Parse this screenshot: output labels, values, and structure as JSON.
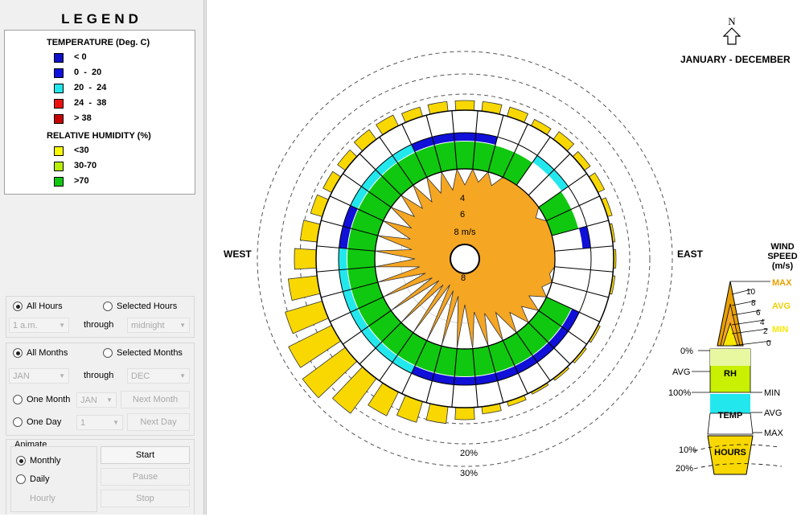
{
  "legend": {
    "title": "LEGEND",
    "temperature_heading": "TEMPERATURE (Deg. C)",
    "temperature_items": [
      {
        "label": "< 0",
        "color": "#1010c8"
      },
      {
        "label": "0  -  20",
        "color": "#1010e0"
      },
      {
        "label": "20  -  24",
        "color": "#22e8ee"
      },
      {
        "label": "24  -  38",
        "color": "#ee1010"
      },
      {
        "label": "> 38",
        "color": "#c80000"
      }
    ],
    "humidity_heading": "RELATIVE HUMIDITY (%)",
    "humidity_items": [
      {
        "label": "<30",
        "color": "#f8f800"
      },
      {
        "label": "30-70",
        "color": "#b8ee00"
      },
      {
        "label": ">70",
        "color": "#10c810"
      }
    ]
  },
  "hours": {
    "all_label": "All Hours",
    "selected_label": "Selected Hours",
    "all_selected": true,
    "from_value": "1 a.m.",
    "through_label": "through",
    "to_value": "midnight"
  },
  "months": {
    "all_label": "All Months",
    "selected_label": "Selected Months",
    "all_selected": true,
    "from_value": "JAN",
    "through_label": "through",
    "to_value": "DEC",
    "one_month_label": "One Month",
    "one_month_value": "JAN",
    "next_month_label": "Next Month",
    "one_day_label": "One Day",
    "one_day_value": "1",
    "next_day_label": "Next Day"
  },
  "animate": {
    "legend": "Animate",
    "monthly_label": "Monthly",
    "daily_label": "Daily",
    "hourly_label": "Hourly",
    "monthly_selected": true,
    "start_label": "Start",
    "pause_label": "Pause",
    "stop_label": "Stop"
  },
  "chart": {
    "north_label": "N",
    "period_label": "JANUARY - DECEMBER",
    "west_label": "WEST",
    "east_label": "EAST",
    "speed_rings": [
      "4",
      "6",
      "8 m/s"
    ],
    "bottom_speed_label": "8",
    "hours_pct_labels": [
      "20%",
      "30%"
    ]
  },
  "key": {
    "title_lines": [
      "WIND",
      "SPEED",
      "(m/s)"
    ],
    "max_label": "MAX",
    "avg_label": "AVG",
    "min_label": "MIN",
    "speed_ticks": [
      "10",
      "8",
      "6",
      "4",
      "2",
      "0"
    ],
    "rh_zero": "0%",
    "rh_avg": "AVG",
    "rh_text": "RH",
    "rh_hundred": "100%",
    "rh_min": "MIN",
    "temp_text": "TEMP",
    "temp_avg": "AVG",
    "temp_max": "MAX",
    "hours_text": "HOURS",
    "hours_10": "10%",
    "hours_20": "20%",
    "max_color": "#e8a000",
    "avg_color": "#f0d000",
    "min_color": "#f8e800"
  },
  "colors": {
    "wind_fill": "#f5a623",
    "hours_fill": "#f8d800",
    "humidity_green": "#10c810",
    "temp_blue": "#1010d8",
    "temp_cyan": "#22e8ee"
  },
  "chart_data": {
    "type": "wind-rose",
    "directions": 36,
    "hours_pct": [
      4,
      4,
      4,
      3,
      4,
      3,
      3,
      2,
      1,
      1,
      1,
      0,
      1,
      1,
      1,
      1,
      2,
      3,
      5,
      7,
      9,
      11,
      18,
      22,
      20,
      16,
      12,
      9,
      7,
      5,
      4,
      4,
      5,
      5,
      4,
      4
    ],
    "humidity_class": [
      ">70",
      ">70",
      ">70",
      ">70",
      "none",
      "none",
      ">70",
      ">70",
      "none",
      "none",
      "none",
      "none",
      ">70",
      ">70",
      ">70",
      ">70",
      ">70",
      ">70",
      ">70",
      ">70",
      ">70",
      ">70",
      ">70",
      ">70",
      ">70",
      ">70",
      ">70",
      ">70",
      ">70",
      ">70",
      ">70",
      ">70",
      ">70",
      ">70",
      ">70",
      ">70"
    ],
    "temp_class": [
      "0-20",
      "0-20",
      "none",
      "none",
      "20-24",
      "20-24",
      "none",
      "none",
      "0-20",
      "none",
      "none",
      "none",
      "0-20",
      "0-20",
      "0-20",
      "0-20",
      "0-20",
      "0-20",
      "0-20",
      "0-20",
      "0-20",
      "20-24",
      "20-24",
      "20-24",
      "20-24",
      "20-24",
      "20-24",
      "20-24",
      "0-20",
      "0-20",
      "20-24",
      "20-24",
      "20-24",
      "20-24",
      "0-20",
      "0-20"
    ],
    "wind_speed_avg": [
      2,
      1.5,
      1.5,
      0,
      0,
      0,
      1,
      0,
      0,
      0,
      0.5,
      1,
      2,
      2,
      2.5,
      3.5,
      4,
      4.5,
      5.5,
      6.5,
      7,
      7.5,
      7,
      7,
      6.5,
      6,
      5.5,
      5,
      4.5,
      4,
      3.5,
      3,
      3,
      3,
      2.5,
      2.5
    ]
  }
}
